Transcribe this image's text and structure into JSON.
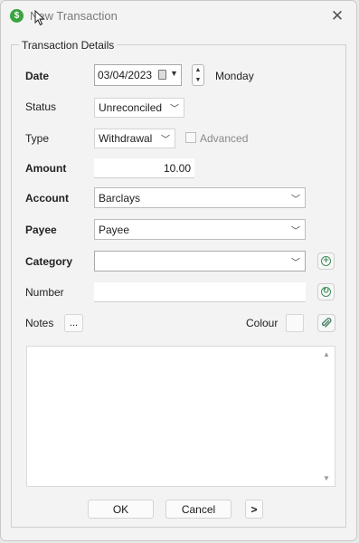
{
  "window": {
    "title": "New Transaction",
    "app_icon_glyph": "$",
    "close_glyph": "✕"
  },
  "group": {
    "title": "Transaction Details"
  },
  "date": {
    "label": "Date",
    "value": "03/04/2023",
    "weekday": "Monday"
  },
  "status": {
    "label": "Status",
    "value": "Unreconciled"
  },
  "type": {
    "label": "Type",
    "value": "Withdrawal",
    "advanced_label": "Advanced",
    "advanced_checked": false
  },
  "amount": {
    "label": "Amount",
    "value": "10.00"
  },
  "account": {
    "label": "Account",
    "value": "Barclays"
  },
  "payee": {
    "label": "Payee",
    "value": "Payee"
  },
  "category": {
    "label": "Category",
    "value": ""
  },
  "number": {
    "label": "Number",
    "value": ""
  },
  "notes": {
    "label": "Notes",
    "button_label": "...",
    "value": ""
  },
  "colour": {
    "label": "Colour"
  },
  "footer": {
    "ok_label": "OK",
    "cancel_label": "Cancel",
    "next_label": ">"
  },
  "icons": {
    "app": "app-logo-icon",
    "close": "close-icon",
    "calendar": "calendar-icon",
    "add_category": "add-circle-icon",
    "number_assign": "circled-arrow-icon",
    "attachment": "paperclip-icon"
  },
  "colors": {
    "accent_green": "#3aa43e"
  }
}
